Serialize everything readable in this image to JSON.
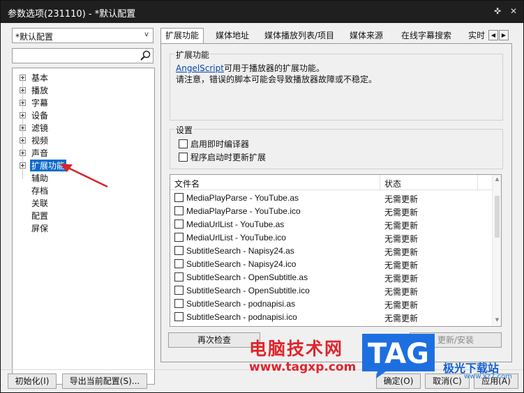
{
  "window": {
    "title": "参数选项(231110) - *默认配置",
    "pin_glyph": "✜",
    "close_glyph": "✕"
  },
  "left": {
    "profile": "*默认配置",
    "dropdown_glyph": "v",
    "search_placeholder": "",
    "tree": [
      {
        "label": "基本",
        "expandable": true
      },
      {
        "label": "播放",
        "expandable": true
      },
      {
        "label": "字幕",
        "expandable": true
      },
      {
        "label": "设备",
        "expandable": true
      },
      {
        "label": "滤镜",
        "expandable": true
      },
      {
        "label": "视频",
        "expandable": true
      },
      {
        "label": "声音",
        "expandable": true
      },
      {
        "label": "扩展功能",
        "expandable": true,
        "selected": true
      },
      {
        "label": "辅助",
        "expandable": false
      },
      {
        "label": "存档",
        "expandable": false
      },
      {
        "label": "关联",
        "expandable": false
      },
      {
        "label": "配置",
        "expandable": false
      },
      {
        "label": "屏保",
        "expandable": false
      }
    ]
  },
  "tabs": {
    "items": [
      "扩展功能",
      "媒体地址",
      "媒体播放列表/项目",
      "媒体来源",
      "在线字幕搜索",
      "实时"
    ],
    "active": "扩展功能",
    "scroll_left": "◀",
    "scroll_right": "▶"
  },
  "extension": {
    "group_title": "扩展功能",
    "link_text": "AngelScript",
    "line1_rest": "可用于播放器的扩展功能。",
    "line2": "请注意，错误的脚本可能会导致播放器故障或不稳定。"
  },
  "settings": {
    "group_title": "设置",
    "options": [
      {
        "label": "启用即时编译器",
        "checked": false
      },
      {
        "label": "程序启动时更新扩展",
        "checked": false
      }
    ]
  },
  "file_list": {
    "columns": [
      "文件名",
      "状态"
    ],
    "rows": [
      {
        "name": "MediaPlayParse - YouTube.as",
        "status": "无需更新",
        "checked": false
      },
      {
        "name": "MediaPlayParse - YouTube.ico",
        "status": "无需更新",
        "checked": false
      },
      {
        "name": "MediaUrlList - YouTube.as",
        "status": "无需更新",
        "checked": false
      },
      {
        "name": "MediaUrlList - YouTube.ico",
        "status": "无需更新",
        "checked": false
      },
      {
        "name": "SubtitleSearch - Napisy24.as",
        "status": "无需更新",
        "checked": false
      },
      {
        "name": "SubtitleSearch - Napisy24.ico",
        "status": "无需更新",
        "checked": false
      },
      {
        "name": "SubtitleSearch - OpenSubtitle.as",
        "status": "无需更新",
        "checked": false
      },
      {
        "name": "SubtitleSearch - OpenSubtitle.ico",
        "status": "无需更新",
        "checked": false
      },
      {
        "name": "SubtitleSearch - podnapisi.as",
        "status": "无需更新",
        "checked": false
      },
      {
        "name": "SubtitleSearch - podnapisi.ico",
        "status": "无需更新",
        "checked": false
      }
    ]
  },
  "buttons": {
    "recheck": "再次检查",
    "update_install": "更新/安装",
    "initialize": "初始化(I)",
    "export": "导出当前配置(S)...",
    "ok": "确定(O)",
    "cancel": "取消(C)",
    "apply": "应用(A)"
  },
  "watermark": {
    "site_name": "电脑技术网",
    "site_url": "www.tagxp.com",
    "logo_text": "TAG",
    "brand": "极光下载站",
    "brand_url": "www.xz7.com",
    "logo_color": "#1d6fe0",
    "text_color": "#e0242b"
  }
}
